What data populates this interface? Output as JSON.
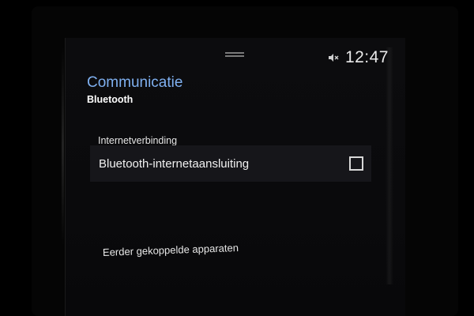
{
  "status_bar": {
    "time": "12:47",
    "mute_icon": "speaker-muted-icon"
  },
  "header": {
    "title": "Communicatie",
    "subtitle": "Bluetooth"
  },
  "sections": [
    {
      "header": "Internetverbinding",
      "items": [
        {
          "label": "Bluetooth-internetaansluiting",
          "checked": false
        }
      ]
    }
  ],
  "list": {
    "previously_paired_label": "Eerder gekoppelde apparaten"
  },
  "colors": {
    "accent_title": "#7fb0f0",
    "background": "#0a0a0c",
    "row_background": "#16161a",
    "text": "#f2f2f2"
  }
}
